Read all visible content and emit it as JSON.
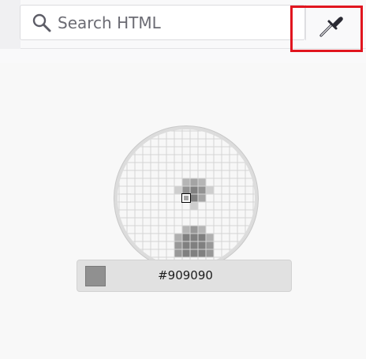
{
  "toolbar": {
    "search": {
      "placeholder": "Search HTML",
      "value": ""
    },
    "eyedropper": {
      "icon": "eyedropper-icon",
      "highlighted": true,
      "highlight_color": "#e1151f"
    }
  },
  "color_picker": {
    "hex_value": "#909090",
    "swatch_color": "#909090",
    "grid_color": "#d4d4d4",
    "dark_pixel_color": "#808080"
  }
}
